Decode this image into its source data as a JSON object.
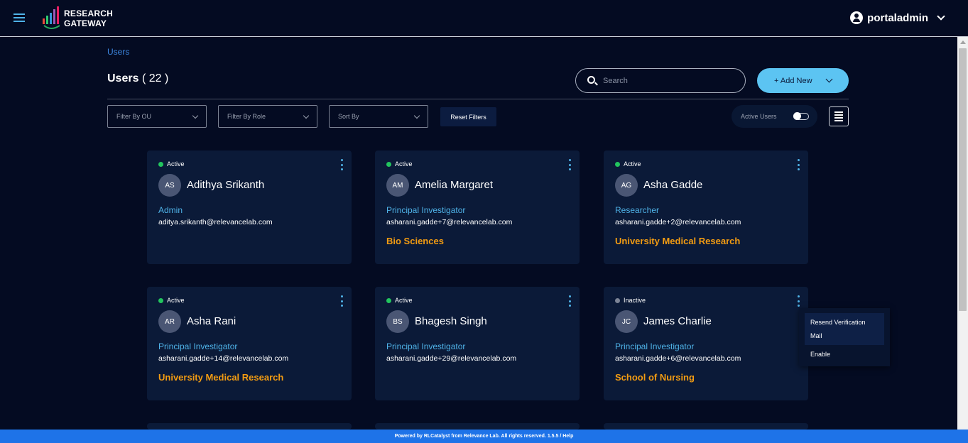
{
  "header": {
    "logo_line1": "RESEARCH",
    "logo_line2": "GATEWAY",
    "username": "portaladmin"
  },
  "breadcrumb": "Users",
  "page": {
    "title": "Users",
    "count": "( 22 )"
  },
  "search": {
    "placeholder": "Search"
  },
  "add_new_label": "+ Add New",
  "filters": {
    "ou": "Filter By OU",
    "role": "Filter By Role",
    "sort": "Sort By",
    "reset": "Reset Filters",
    "active_users": "Active Users"
  },
  "users": [
    {
      "status": "Active",
      "initials": "AS",
      "name": "Adithya Srikanth",
      "role": "Admin",
      "email": "aditya.srikanth@relevancelab.com",
      "org": ""
    },
    {
      "status": "Active",
      "initials": "AM",
      "name": "Amelia Margaret",
      "role": "Principal Investigator",
      "email": "asharani.gadde+7@relevancelab.com",
      "org": "Bio Sciences"
    },
    {
      "status": "Active",
      "initials": "AG",
      "name": "Asha Gadde",
      "role": "Researcher",
      "email": "asharani.gadde+2@relevancelab.com",
      "org": "University Medical Research"
    },
    {
      "status": "Active",
      "initials": "AR",
      "name": "Asha Rani",
      "role": "Principal Investigator",
      "email": "asharani.gadde+14@relevancelab.com",
      "org": "University Medical Research"
    },
    {
      "status": "Active",
      "initials": "BS",
      "name": "Bhagesh Singh",
      "role": "Principal Investigator",
      "email": "asharani.gadde+29@relevancelab.com",
      "org": ""
    },
    {
      "status": "Inactive",
      "initials": "JC",
      "name": "James Charlie",
      "role": "Principal Investigator",
      "email": "asharani.gadde+6@relevancelab.com",
      "org": "School of Nursing"
    }
  ],
  "context_menu": {
    "item1_line1": "Resend Verification",
    "item1_line2": "Mail",
    "item2": "Enable"
  },
  "footer": "Powered by RLCatalyst from Relevance Lab. All rights reserved. 1.5.5 / Help",
  "colors": {
    "background": "#040b22",
    "card": "#0b1a38",
    "accent": "#5cc4f2",
    "role": "#4fb3e8",
    "org": "#f39c12",
    "active_dot": "#22c55e",
    "footer": "#1e73e8"
  }
}
